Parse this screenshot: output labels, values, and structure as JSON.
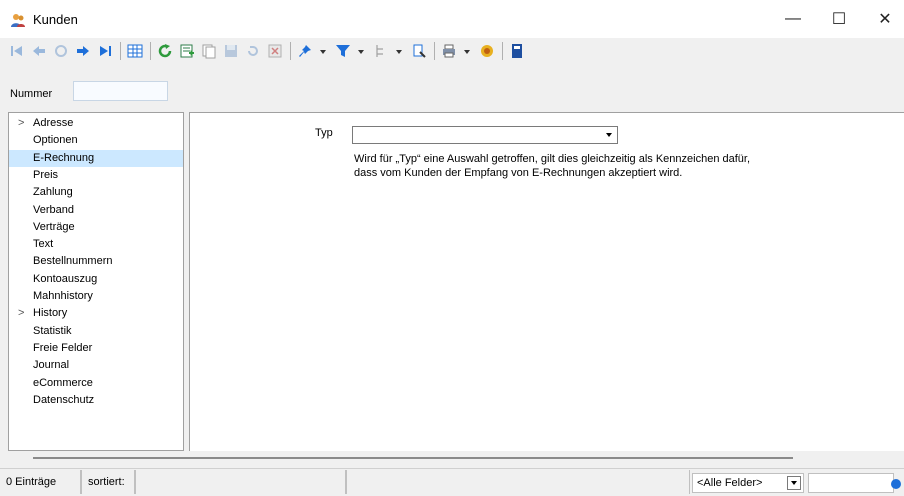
{
  "window": {
    "title": "Kunden"
  },
  "window_controls": {
    "minimize": "—",
    "maximize": "☐",
    "close": "✕"
  },
  "filter": {
    "label": "Nummer",
    "value": ""
  },
  "tree": {
    "items": [
      {
        "label": "Adresse",
        "expandable": true,
        "selected": false
      },
      {
        "label": "Optionen",
        "expandable": false,
        "selected": false
      },
      {
        "label": "E-Rechnung",
        "expandable": false,
        "selected": true
      },
      {
        "label": "Preis",
        "expandable": false,
        "selected": false
      },
      {
        "label": "Zahlung",
        "expandable": false,
        "selected": false
      },
      {
        "label": "Verband",
        "expandable": false,
        "selected": false
      },
      {
        "label": "Verträge",
        "expandable": false,
        "selected": false
      },
      {
        "label": "Text",
        "expandable": false,
        "selected": false
      },
      {
        "label": "Bestellnummern",
        "expandable": false,
        "selected": false
      },
      {
        "label": "Kontoauszug",
        "expandable": false,
        "selected": false
      },
      {
        "label": "Mahnhistory",
        "expandable": false,
        "selected": false
      },
      {
        "label": "History",
        "expandable": true,
        "selected": false
      },
      {
        "label": "Statistik",
        "expandable": false,
        "selected": false
      },
      {
        "label": "Freie Felder",
        "expandable": false,
        "selected": false
      },
      {
        "label": "Journal",
        "expandable": false,
        "selected": false
      },
      {
        "label": "eCommerce",
        "expandable": false,
        "selected": false
      },
      {
        "label": "Datenschutz",
        "expandable": false,
        "selected": false
      }
    ]
  },
  "form": {
    "typ_label": "Typ",
    "typ_value": "",
    "help_line1": "Wird für „Typ“ eine Auswahl getroffen, gilt dies gleichzeitig als Kennzeichen dafür,",
    "help_line2": "dass vom Kunden der Empfang von E-Rechnungen akzeptiert wird."
  },
  "status": {
    "entries": "0 Einträge",
    "sorted": "sortiert:",
    "field_filter": "<Alle Felder>"
  },
  "colors": {
    "selection": "#cce8ff",
    "accent_blue": "#1e6fd9",
    "green": "#2e9a3c"
  }
}
